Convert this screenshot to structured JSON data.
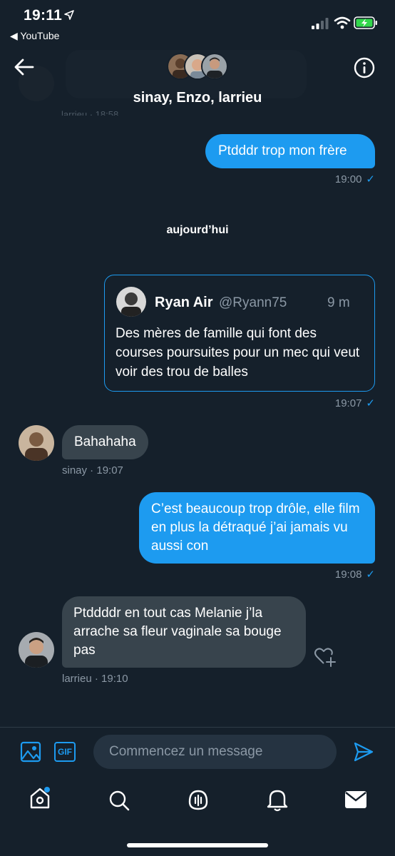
{
  "status_bar": {
    "time": "19:11",
    "back_app": "◀ YouTube"
  },
  "header": {
    "title": "sinay, Enzo, larrieu",
    "partial_meta": "larrieu · 18:58"
  },
  "messages": [
    {
      "id": "m1",
      "dir": "out",
      "text": "Ptdddr trop mon frère",
      "time": "19:00"
    },
    {
      "id": "sep",
      "type": "date",
      "text": "aujourd’hui"
    },
    {
      "id": "m2",
      "dir": "out",
      "type": "quote",
      "time": "19:07",
      "quote": {
        "name": "Ryan Air",
        "handle": "@Ryann75",
        "age": "9 m",
        "text": "Des mères de famille qui font des courses poursuites pour un mec qui veut voir des trou de balles"
      }
    },
    {
      "id": "m3",
      "dir": "in",
      "text": "Bahahaha",
      "meta": "sinay · 19:07"
    },
    {
      "id": "m4",
      "dir": "out",
      "text": "C’est beaucoup trop drôle, elle film en plus la détraqué j’ai jamais vu aussi con",
      "time": "19:08"
    },
    {
      "id": "m5",
      "dir": "in",
      "text": "Ptddddr en tout cas Melanie j’la arrache sa fleur vaginale sa bouge pas",
      "meta": "larrieu · 19:10"
    }
  ],
  "composer": {
    "placeholder": "Commencez un message",
    "gif_label": "GIF"
  },
  "colors": {
    "background": "#15202b",
    "accent": "#1d9bf0",
    "incoming_bubble": "#38444d",
    "muted_text": "#8b98a5"
  },
  "icons": {
    "back": "arrow-left-icon",
    "info": "info-icon",
    "image": "image-icon",
    "gif": "gif-icon",
    "send": "send-icon",
    "home": "home-icon",
    "search": "search-icon",
    "spaces": "microphone-icon",
    "notifications": "bell-icon",
    "messages": "envelope-icon",
    "like": "heart-plus-icon"
  }
}
